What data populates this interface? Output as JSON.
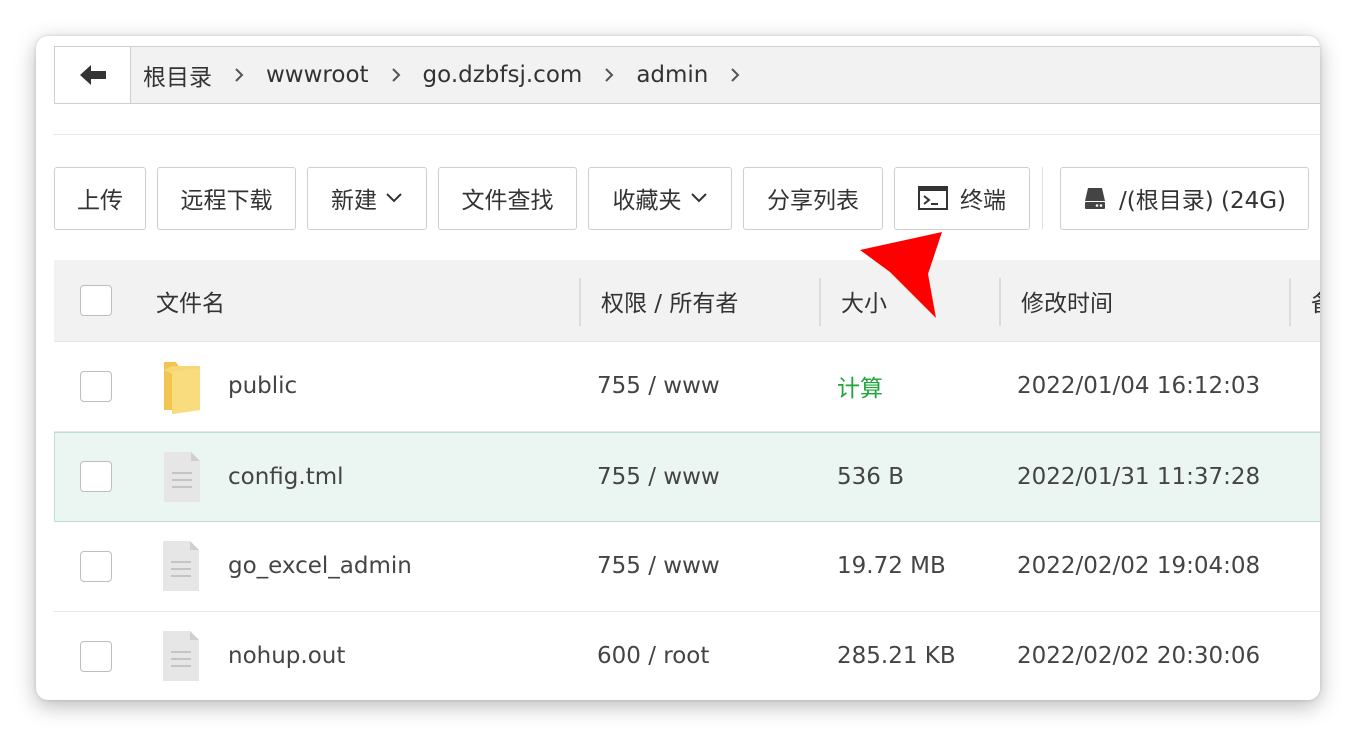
{
  "breadcrumb": {
    "items": [
      "根目录",
      "wwwroot",
      "go.dzbfsj.com",
      "admin"
    ]
  },
  "toolbar": {
    "upload": "上传",
    "remote_download": "远程下载",
    "new": "新建",
    "file_search": "文件查找",
    "favorites": "收藏夹",
    "share_list": "分享列表",
    "terminal": "终端",
    "disk": "/(根目录) (24G)"
  },
  "table": {
    "headers": {
      "name": "文件名",
      "perm": "权限 / 所有者",
      "size": "大小",
      "mtime": "修改时间",
      "extra": "备"
    },
    "rows": [
      {
        "name": "public",
        "perm": "755 / www",
        "size": "计算",
        "mtime": "2022/01/04 16:12:03",
        "type": "folder"
      },
      {
        "name": "config.tml",
        "perm": "755 / www",
        "size": "536 B",
        "mtime": "2022/01/31 11:37:28",
        "type": "file"
      },
      {
        "name": "go_excel_admin",
        "perm": "755 / www",
        "size": "19.72 MB",
        "mtime": "2022/02/02 19:04:08",
        "type": "file"
      },
      {
        "name": "nohup.out",
        "perm": "600 / root",
        "size": "285.21 KB",
        "mtime": "2022/02/02 20:30:06",
        "type": "file"
      }
    ]
  },
  "colors": {
    "calc_green": "#20a53a",
    "selected_row": "#ebf6f3",
    "pointer_red": "#ff0000"
  },
  "icons": {
    "back": "arrow-left-icon",
    "chevron": "chevron-right-icon",
    "caret": "chevron-down-icon",
    "terminal": "terminal-icon",
    "disk": "hard-drive-icon",
    "folder": "folder-icon",
    "file": "file-icon",
    "pointer": "red-arrow-pointer"
  }
}
